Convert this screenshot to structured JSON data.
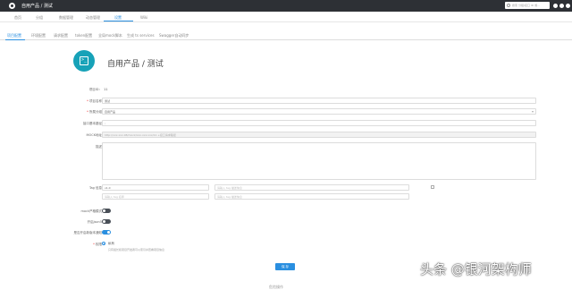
{
  "topbar": {
    "title": "自用产品 / 测试",
    "search_placeholder": "搜索 分组/接口 ID 或..."
  },
  "nav": {
    "items": [
      "首页",
      "分组",
      "数据管理",
      "动态管理",
      "设置",
      "Wiki"
    ]
  },
  "tabs": [
    "项目配置",
    "环境配置",
    "请求配置",
    "token配置",
    "全局mock脚本",
    "生成 ts services",
    "Swagger自动同步"
  ],
  "header": {
    "title": "自用产品 / 测试",
    "icon": "terminal-icon"
  },
  "form": {
    "project_id_label": "项目ID：",
    "project_id_value": "11",
    "project_name_label": "项目名称",
    "project_name_value": "测试",
    "group_label": "所属分组",
    "group_value": "自用产品",
    "base_path_label": "接口基本路径",
    "base_path_placeholder": "/",
    "mock_label": "MOCK地址",
    "mock_value": "http://xxx.xxx.98/mock/xxx.xxx.xxx/11 +接口请求路径",
    "desc_label": "描述",
    "tag_label": "Tag 信息",
    "tag_rows": [
      {
        "name": "v1.0",
        "desc_placeholder": "请输入 tag 描述信息"
      },
      {
        "name_placeholder": "请输入 tag 名称",
        "desc_placeholder": "请输入 tag 描述信息"
      }
    ],
    "strict_label": "mock严格模式",
    "json_label": "开启json5",
    "switch_label": "是否开启新版本通知",
    "permission_label": "权限",
    "permission_option": "私有",
    "permission_hint": "只有组长和项目开发者可以索引并查看项目信息",
    "save_label": "保 存"
  },
  "danger": {
    "title": "危险操作"
  },
  "watermark": "头条 @银河架构师",
  "colors": {
    "accent": "#2a8fe0",
    "topbar": "#2d3035",
    "icon_bg": "#17a2b8"
  }
}
